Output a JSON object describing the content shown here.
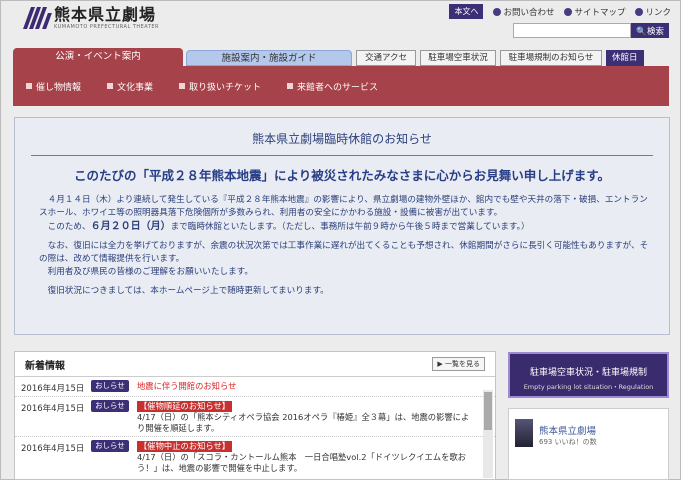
{
  "header": {
    "title": "熊本県立劇場",
    "subtitle": "KUMAMOTO PREFECTURAL THEATER",
    "english_label": "本文へ",
    "links": [
      "お問い合わせ",
      "サイトマップ",
      "リンク"
    ],
    "search_placeholder": "",
    "search_button": "検索"
  },
  "nav": {
    "tab_events": "公演・イベント案内",
    "tab_facilities": "施設案内・施設ガイド",
    "tab_access": "交通アクセス",
    "tab_parking": "駐車場空車状況",
    "tab_parking_rules": "駐車場規制のお知らせ",
    "tab_closed": "休館日"
  },
  "subnav": [
    "催し物情報",
    "文化事業",
    "取り扱いチケット",
    "来館者へのサービス"
  ],
  "notice": {
    "title": "熊本県立劇場臨時休館のお知らせ",
    "headline": "このたびの「平成２８年熊本地震」により被災されたみなさまに心からお見舞い申し上げます。",
    "p1": "　４月１４日（木）より連続して発生している『平成２８年熊本地震』の影響により、県立劇場の建物外壁ほか、館内でも壁や天井の落下・破損、エントランスホール、ホワイエ等の照明器具落下危険個所が多数みられ、利用者の安全にかかわる施設・設備に被害が出ています。",
    "p2_pre": "　このため、",
    "p2_date": "６月２０日（月）",
    "p2_post": "まで臨時休館といたします。（ただし、事務所は午前９時から午後５時まで営業しています。）",
    "p3": "　なお、復旧には全力を挙げておりますが、余震の状況次第では工事作業に遅れが出てくることも予想され、休館期間がさらに長引く可能性もありますが、その際は、改めて情報提供を行います。",
    "p4": "　利用者及び県民の皆様のご理解をお願いいたします。",
    "p5": "　復旧状況につきましては、本ホームページ上で随時更新してまいります。"
  },
  "news": {
    "title": "新着情報",
    "more": "一覧を見る",
    "items": [
      {
        "date": "2016年4月15日",
        "badge": "おしらせ",
        "tag": "",
        "text": "地震に伴う開館のお知らせ"
      },
      {
        "date": "2016年4月15日",
        "badge": "おしらせ",
        "tag": "【催物順延のお知らせ】",
        "text": "4/17（日）の「熊本シティオペラ協会 2016オペラ『椿姫』全３幕」は、地震の影響により開催を順延します。"
      },
      {
        "date": "2016年4月15日",
        "badge": "おしらせ",
        "tag": "【催物中止のお知らせ】",
        "text": "4/17（日）の「スコラ・カントールム熊本　一日合唱塾vol.2「ドイツレクイエムを歌おう！」は、地震の影響で開催を中止します。"
      }
    ]
  },
  "sidebar": {
    "parking_banner_title": "駐車場空車状況・駐車場規制",
    "parking_banner_sub": "Empty parking lot situation・Regulation",
    "fb_name": "熊本県立劇場",
    "fb_likes": "693 いいね！の数"
  }
}
